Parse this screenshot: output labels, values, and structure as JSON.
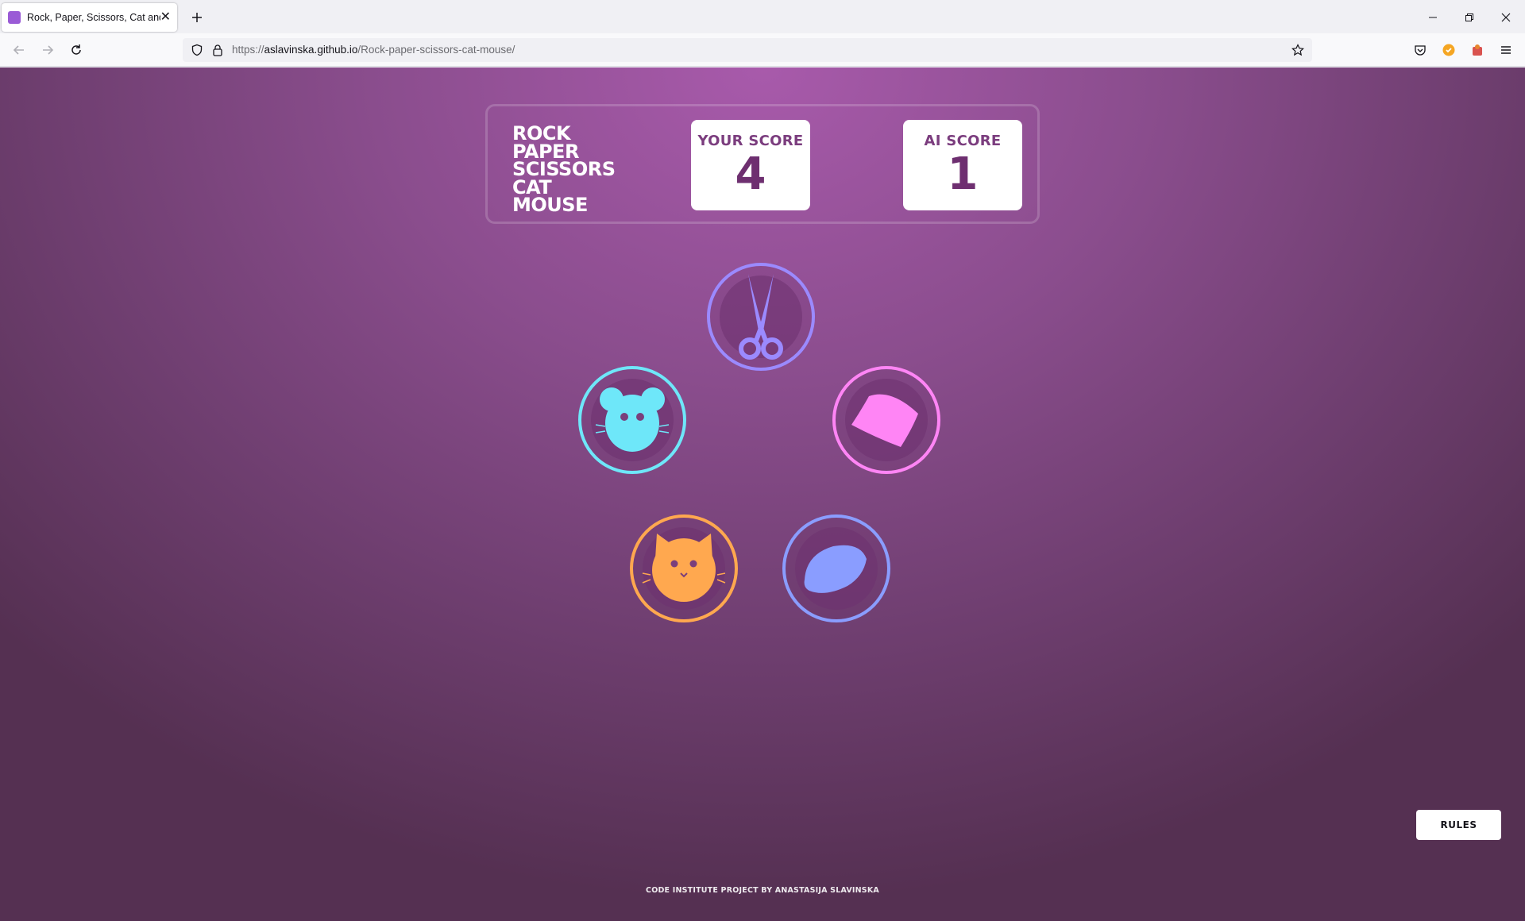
{
  "browser": {
    "tab_title": "Rock, Paper, Scissors, Cat and Mouse",
    "new_tab_icon": "plus-icon",
    "url_scheme": "https://",
    "url_host": "aslavinska.github.io",
    "url_path": "/Rock-paper-scissors-cat-mouse/"
  },
  "game": {
    "title_lines": [
      "ROCK",
      "PAPER",
      "SCISSORS",
      "CAT",
      "MOUSE"
    ],
    "your_score_label": "YOUR SCORE",
    "your_score": "4",
    "ai_score_label": "AI SCORE",
    "ai_score": "1",
    "choices": [
      {
        "id": "scissors",
        "icon": "scissors-icon",
        "color": "#9b8aff"
      },
      {
        "id": "mouse",
        "icon": "mouse-icon",
        "color": "#6ee7f9"
      },
      {
        "id": "paper",
        "icon": "paper-icon",
        "color": "#ff85f5"
      },
      {
        "id": "cat",
        "icon": "cat-icon",
        "color": "#ffa84f"
      },
      {
        "id": "rock",
        "icon": "rock-icon",
        "color": "#8a9dff"
      }
    ]
  },
  "footer": {
    "rules_label": "RULES",
    "credit": "CODE INSTITUTE PROJECT BY ANASTASIJA SLAVINSKA"
  }
}
